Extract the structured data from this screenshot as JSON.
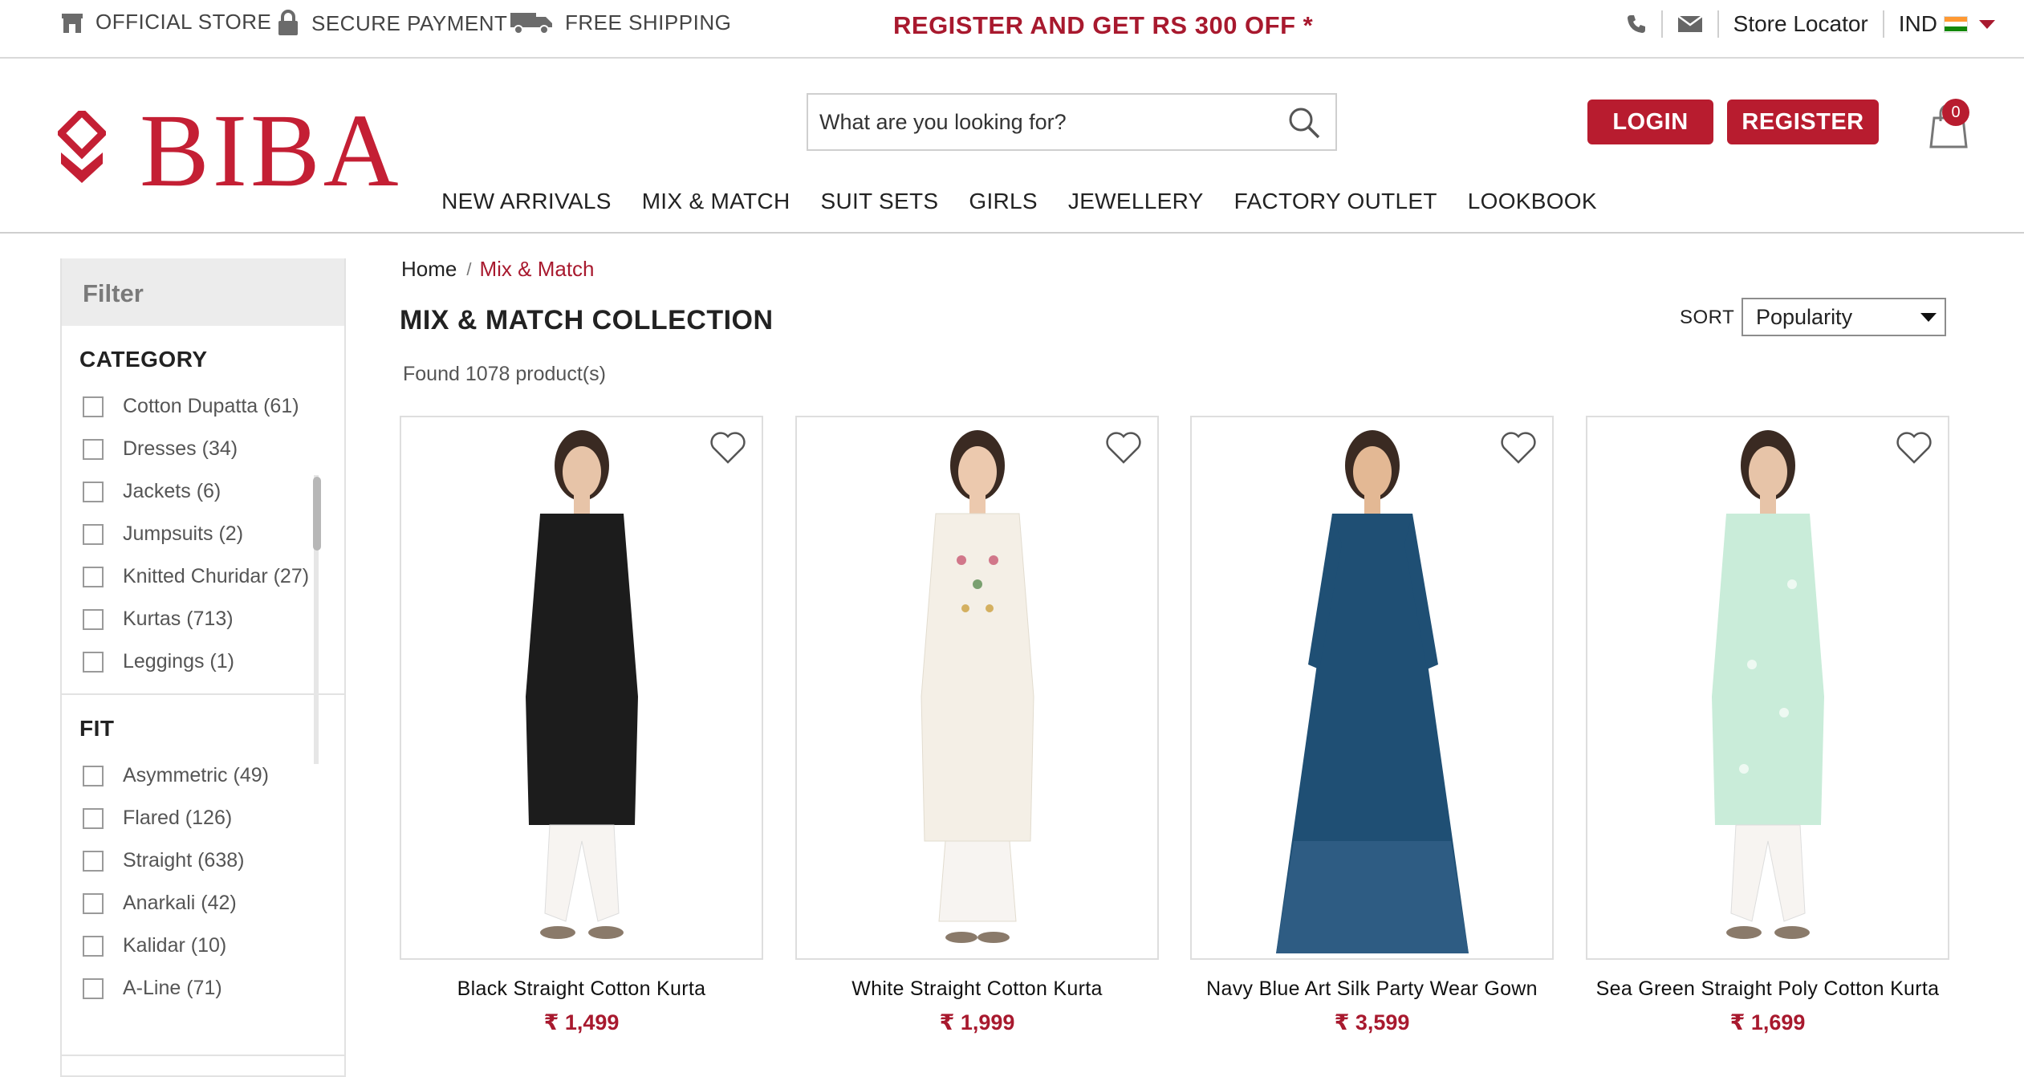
{
  "topbar": {
    "official_store": "OFFICIAL STORE",
    "secure_payment": "SECURE PAYMENT",
    "free_shipping": "FREE SHIPPING",
    "promo": "REGISTER AND GET RS 300 OFF *",
    "store_locator": "Store Locator",
    "country": "IND"
  },
  "header": {
    "logo": "BIBA",
    "search_placeholder": "What are you looking for?",
    "login": "LOGIN",
    "register": "REGISTER",
    "cart_count": "0"
  },
  "nav": [
    "NEW ARRIVALS",
    "MIX & MATCH",
    "SUIT SETS",
    "GIRLS",
    "JEWELLERY",
    "FACTORY OUTLET",
    "LOOKBOOK"
  ],
  "filter": {
    "title": "Filter",
    "category": {
      "title": "CATEGORY",
      "options": [
        "Cotton Dupatta (61)",
        "Dresses (34)",
        "Jackets (6)",
        "Jumpsuits (2)",
        "Knitted Churidar (27)",
        "Kurtas (713)",
        "Leggings (1)"
      ]
    },
    "fit": {
      "title": "FIT",
      "options": [
        "Asymmetric (49)",
        "Flared (126)",
        "Straight (638)",
        "Anarkali (42)",
        "Kalidar (10)",
        "A-Line (71)"
      ]
    }
  },
  "breadcrumb": {
    "home": "Home",
    "sep": "/",
    "current": "Mix & Match"
  },
  "page_title": "MIX & MATCH COLLECTION",
  "found_text": "Found 1078 product(s)",
  "sort": {
    "label": "SORT",
    "value": "Popularity"
  },
  "products": [
    {
      "name": "Black Straight Cotton Kurta",
      "price": "₹ 1,499",
      "color": "#1c1c1c"
    },
    {
      "name": "White Straight Cotton Kurta",
      "price": "₹ 1,999",
      "color": "#f4efe6"
    },
    {
      "name": "Navy Blue Art Silk Party Wear Gown",
      "price": "₹ 3,599",
      "color": "#1f4f74"
    },
    {
      "name": "Sea Green Straight Poly Cotton Kurta",
      "price": "₹ 1,699",
      "color": "#c9ecd9"
    }
  ],
  "colors": {
    "brand": "#b81c2f",
    "accent_text": "#a8192e"
  }
}
